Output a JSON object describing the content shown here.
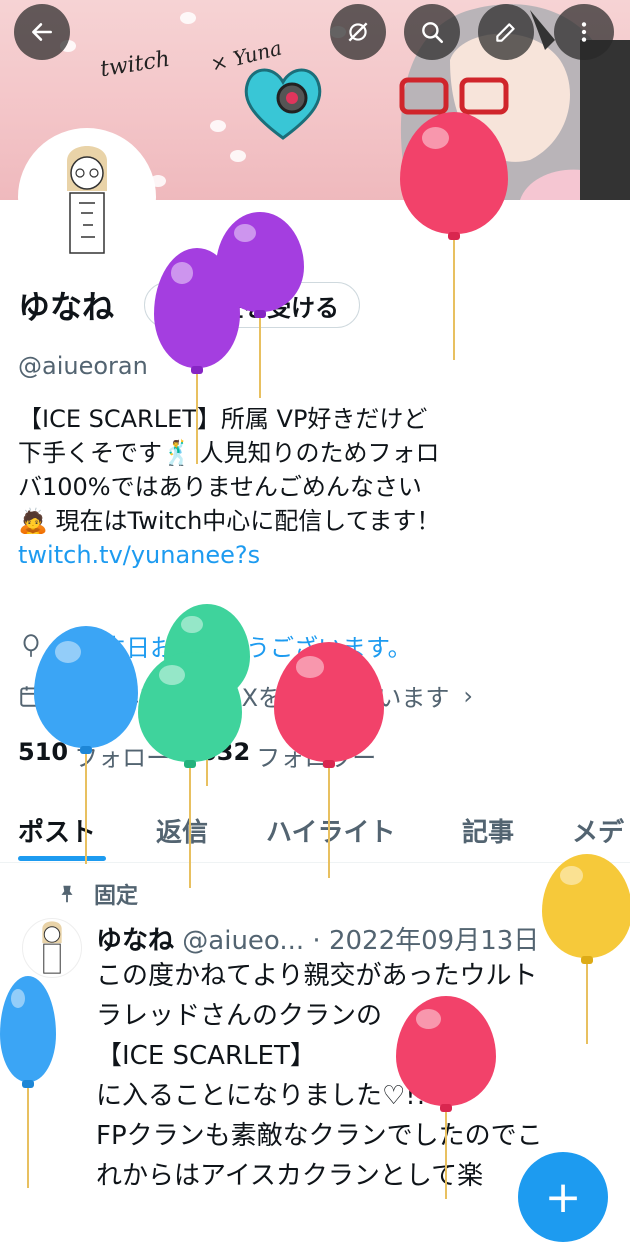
{
  "banner": {
    "text_left": "twitch",
    "text_right": "× Yuna"
  },
  "nav": {
    "back_icon": "arrow-left-icon",
    "icons": [
      "eye-off-icon",
      "search-icon",
      "edit-icon",
      "more-vertical-icon"
    ]
  },
  "profile": {
    "display_name": "ゆなね",
    "verify_button_label": "認証を受ける",
    "handle": "@aiueoran",
    "bio_lines": [
      "【ICE SCARLET】所属  VP好きだけど",
      "下手くそです🕺 人見知りのためフォロ",
      "バ100%ではありませんごめんなさい",
      "🙇 現在はTwitch中心に配信してます！"
    ],
    "link": "twitch.tv/yunanee?s",
    "birthday_text": "お誕生日おめでとうございます。",
    "joined_text": "2015年10月からXを利用しています",
    "following_count": "510",
    "following_label": "フォロー",
    "followers_count": "632",
    "followers_label": "フォロワー"
  },
  "tabs": [
    "ポスト",
    "返信",
    "ハイライト",
    "記事",
    "メデ"
  ],
  "pinned_tweet": {
    "pinned_label": "固定",
    "author_name": "ゆなね",
    "author_handle": "@aiueo...",
    "date": "· 2022年09月13日",
    "body_lines": [
      "この度かねてより親交があったウルト",
      "ラレッドさんのクランの",
      "【ICE SCARLET】",
      "に入ることになりました♡!!",
      "FPクランも素敵なクランでしたのでこ",
      "れからはアイスカクランとして楽"
    ]
  },
  "fab_label": "+",
  "colors": {
    "accent": "#1d9bf0",
    "text": "#0f1419",
    "muted": "#536471"
  }
}
